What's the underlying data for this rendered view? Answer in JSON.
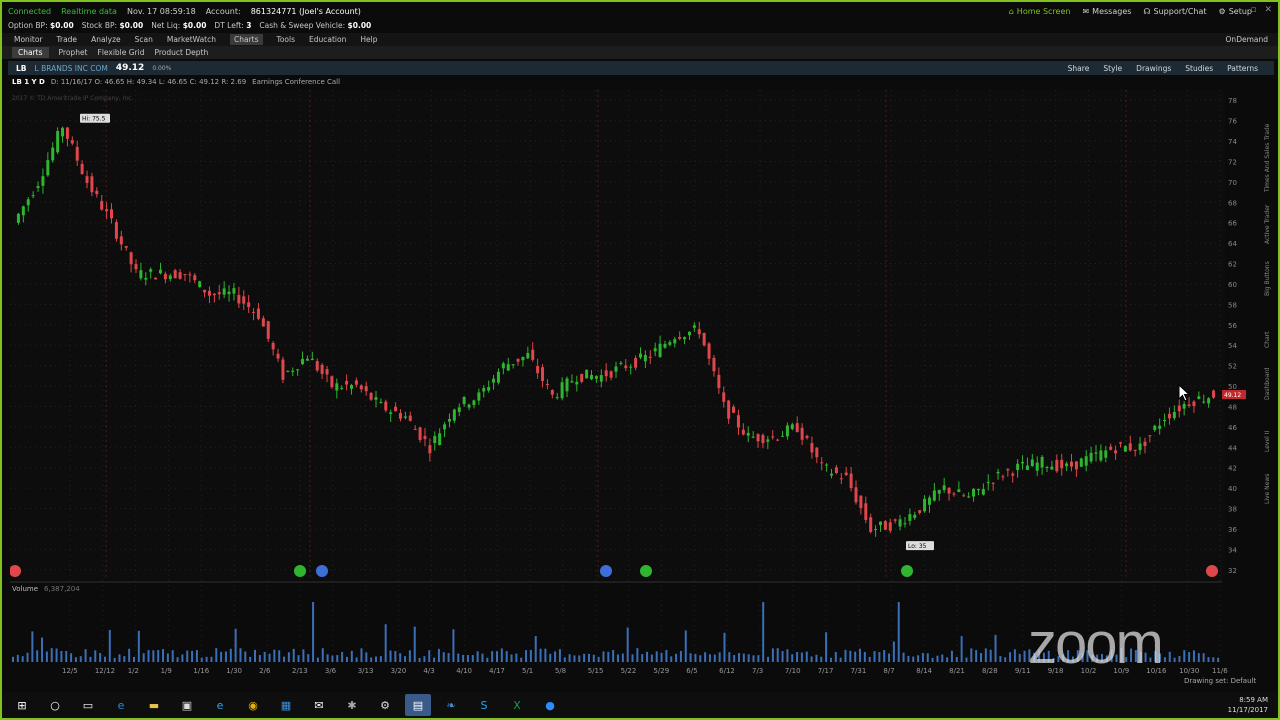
{
  "status": {
    "connected": "Connected",
    "data_mode": "Realtime data",
    "time": "Nov. 17 08:59:18",
    "account_label": "Account:",
    "account": "861324771 (Joel's Account)",
    "home_screen": "Home Screen",
    "messages": "Messages",
    "support": "Support/Chat",
    "setup": "Setup"
  },
  "account_bar": [
    {
      "label": "Option BP",
      "value": "$0.00"
    },
    {
      "label": "Stock BP",
      "value": "$0.00"
    },
    {
      "label": "Net Liq",
      "value": "$0.00"
    },
    {
      "label": "DT Left",
      "value": "3"
    },
    {
      "label": "Cash & Sweep Vehicle",
      "value": "$0.00"
    }
  ],
  "menu": [
    "Monitor",
    "Trade",
    "Analyze",
    "Scan",
    "MarketWatch",
    "Charts",
    "Tools",
    "Education",
    "Help"
  ],
  "menu_active": "Charts",
  "ondemand": "OnDemand",
  "subtabs": [
    "Charts",
    "Prophet",
    "Flexible Grid",
    "Product Depth"
  ],
  "chart_toolbar": {
    "symbol": "LB",
    "company": "L BRANDS INC COM",
    "price": "49.12",
    "change": "0.00%",
    "tools": [
      "Share",
      "Style",
      "Drawings",
      "Studies",
      "Patterns"
    ]
  },
  "info_line": {
    "symbol": "LB 1 Y D",
    "text": "D: 11/16/17  O: 46.65  H: 49.34  L: 46.65  C: 49.12  R: 2.69",
    "event": "Earnings Conference Call"
  },
  "copyright": "2017 © TD Ameritrade IP Company, Inc.",
  "hi_label": "Hi: 75.5",
  "lo_label": "Lo: 35",
  "last_price_tag": "49.12",
  "volume": {
    "label": "Volume",
    "value": "6,387,204"
  },
  "zoom_logo": "zoom",
  "drawing_set": "Drawing set: Default",
  "right_strip": [
    "Trade",
    "Times And Sales",
    "Active Trader",
    "Big Buttons",
    "Chart",
    "Dashboard",
    "Level II",
    "Live News"
  ],
  "clock": {
    "time": "8:59 AM",
    "date": "11/17/2017"
  },
  "colors": {
    "up": "#2fb52f",
    "down": "#e0474c",
    "frame": "#7fc31c",
    "grid": "#2a2a2a"
  },
  "chart_data": {
    "type": "candlestick",
    "title": "",
    "ylim": [
      31,
      79
    ],
    "y_ticks": [
      32,
      34,
      36,
      38,
      40,
      42,
      44,
      46,
      48,
      50,
      52,
      54,
      56,
      58,
      60,
      62,
      64,
      66,
      68,
      70,
      72,
      74,
      76,
      78
    ],
    "x_ticks": [
      "12/5",
      "12/12",
      "1/2",
      "1/9",
      "1/16",
      "1/30",
      "2/6",
      "2/13",
      "3/6",
      "3/13",
      "3/20",
      "4/3",
      "4/10",
      "4/17",
      "5/1",
      "5/8",
      "5/15",
      "5/22",
      "5/29",
      "6/5",
      "6/12",
      "7/3",
      "7/10",
      "7/17",
      "7/31",
      "8/7",
      "8/14",
      "8/21",
      "8/28",
      "9/11",
      "9/18",
      "10/2",
      "10/9",
      "10/16",
      "10/30",
      "11/6"
    ],
    "approx_close_path": [
      {
        "x": "12/1",
        "y": 66
      },
      {
        "x": "12/5",
        "y": 70
      },
      {
        "x": "12/12",
        "y": 75.5
      },
      {
        "x": "12/19",
        "y": 70
      },
      {
        "x": "1/2",
        "y": 66
      },
      {
        "x": "1/9",
        "y": 61
      },
      {
        "x": "1/16",
        "y": 61
      },
      {
        "x": "1/23",
        "y": 61
      },
      {
        "x": "1/30",
        "y": 59
      },
      {
        "x": "2/6",
        "y": 59
      },
      {
        "x": "2/13",
        "y": 57
      },
      {
        "x": "2/27",
        "y": 51
      },
      {
        "x": "3/6",
        "y": 53
      },
      {
        "x": "3/13",
        "y": 50
      },
      {
        "x": "3/20",
        "y": 50
      },
      {
        "x": "3/27",
        "y": 48
      },
      {
        "x": "4/3",
        "y": 47
      },
      {
        "x": "4/10",
        "y": 44
      },
      {
        "x": "4/17",
        "y": 48
      },
      {
        "x": "4/24",
        "y": 49
      },
      {
        "x": "5/1",
        "y": 52
      },
      {
        "x": "5/8",
        "y": 53
      },
      {
        "x": "5/15",
        "y": 49
      },
      {
        "x": "5/22",
        "y": 51
      },
      {
        "x": "5/29",
        "y": 51
      },
      {
        "x": "6/5",
        "y": 52
      },
      {
        "x": "6/12",
        "y": 53
      },
      {
        "x": "6/19",
        "y": 55
      },
      {
        "x": "6/26",
        "y": 55.5
      },
      {
        "x": "7/3",
        "y": 48
      },
      {
        "x": "7/10",
        "y": 45
      },
      {
        "x": "7/17",
        "y": 45
      },
      {
        "x": "7/24",
        "y": 46
      },
      {
        "x": "7/31",
        "y": 42
      },
      {
        "x": "8/7",
        "y": 41
      },
      {
        "x": "8/14",
        "y": 36
      },
      {
        "x": "8/21",
        "y": 36.5
      },
      {
        "x": "8/28",
        "y": 38
      },
      {
        "x": "9/4",
        "y": 40
      },
      {
        "x": "9/11",
        "y": 39
      },
      {
        "x": "9/18",
        "y": 41
      },
      {
        "x": "9/25",
        "y": 42
      },
      {
        "x": "10/2",
        "y": 42.5
      },
      {
        "x": "10/9",
        "y": 42
      },
      {
        "x": "10/16",
        "y": 43
      },
      {
        "x": "10/23",
        "y": 44
      },
      {
        "x": "10/30",
        "y": 44
      },
      {
        "x": "11/6",
        "y": 47
      },
      {
        "x": "11/13",
        "y": 48.5
      },
      {
        "x": "11/16",
        "y": 49.12
      }
    ]
  }
}
